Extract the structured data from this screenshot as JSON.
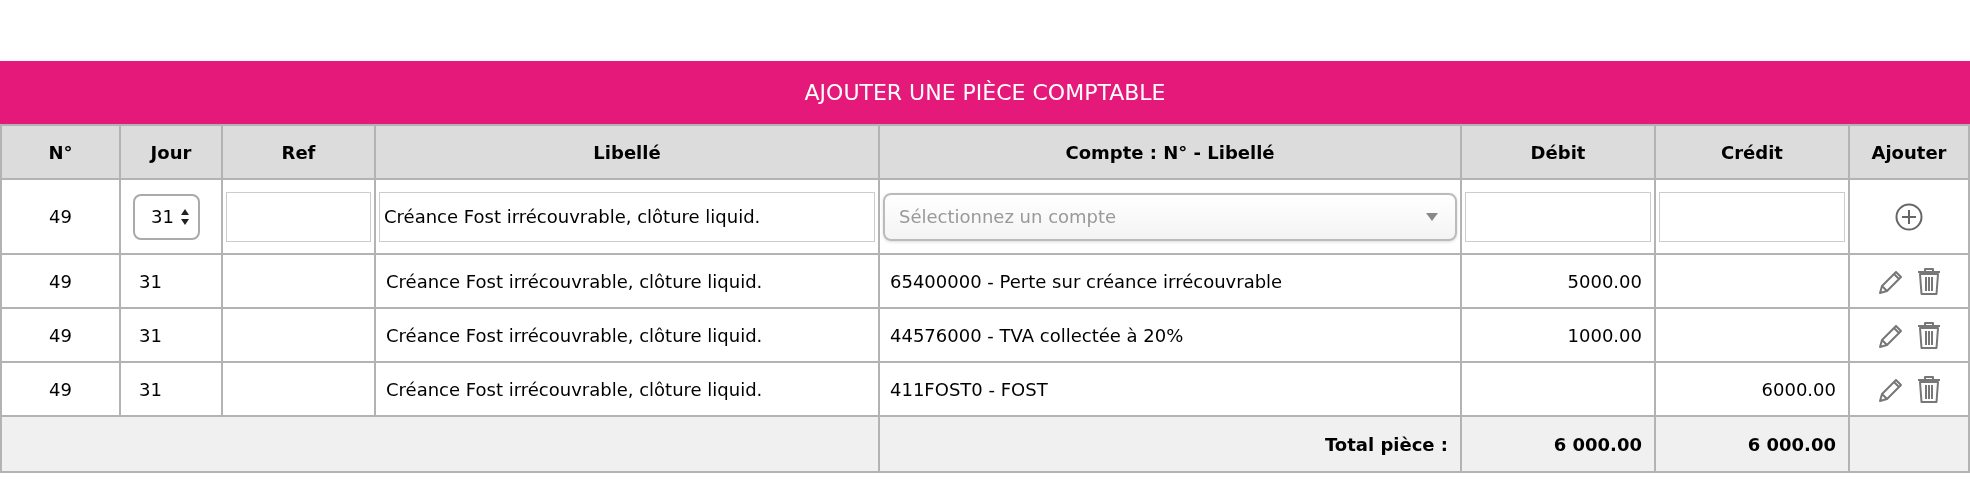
{
  "title": "AJOUTER UNE PIÈCE COMPTABLE",
  "columns": [
    "N°",
    "Jour",
    "Ref",
    "Libellé",
    "Compte : N° - Libellé",
    "Débit",
    "Crédit",
    "Ajouter"
  ],
  "entry_row": {
    "number": "49",
    "day": "31",
    "label_value": "Créance Fost irrécouvrable, clôture liquid.",
    "account_placeholder": "Sélectionnez un compte"
  },
  "rows": [
    {
      "number": "49",
      "day": "31",
      "label": "Créance Fost irrécouvrable, clôture liquid.",
      "account": "65400000 - Perte sur créance irrécouvrable",
      "debit": "5000.00"
    },
    {
      "number": "49",
      "day": "31",
      "label": "Créance Fost irrécouvrable, clôture liquid.",
      "account": "44576000 - TVA collectée à 20%",
      "debit": "1000.00"
    },
    {
      "number": "49",
      "day": "31",
      "label": "Créance Fost irrécouvrable, clôture liquid.",
      "account": "411FOST0 - FOST",
      "credit": "6000.00"
    }
  ],
  "total": {
    "label": "Total pièce :",
    "debit": "6 000.00",
    "credit": "6 000.00"
  }
}
